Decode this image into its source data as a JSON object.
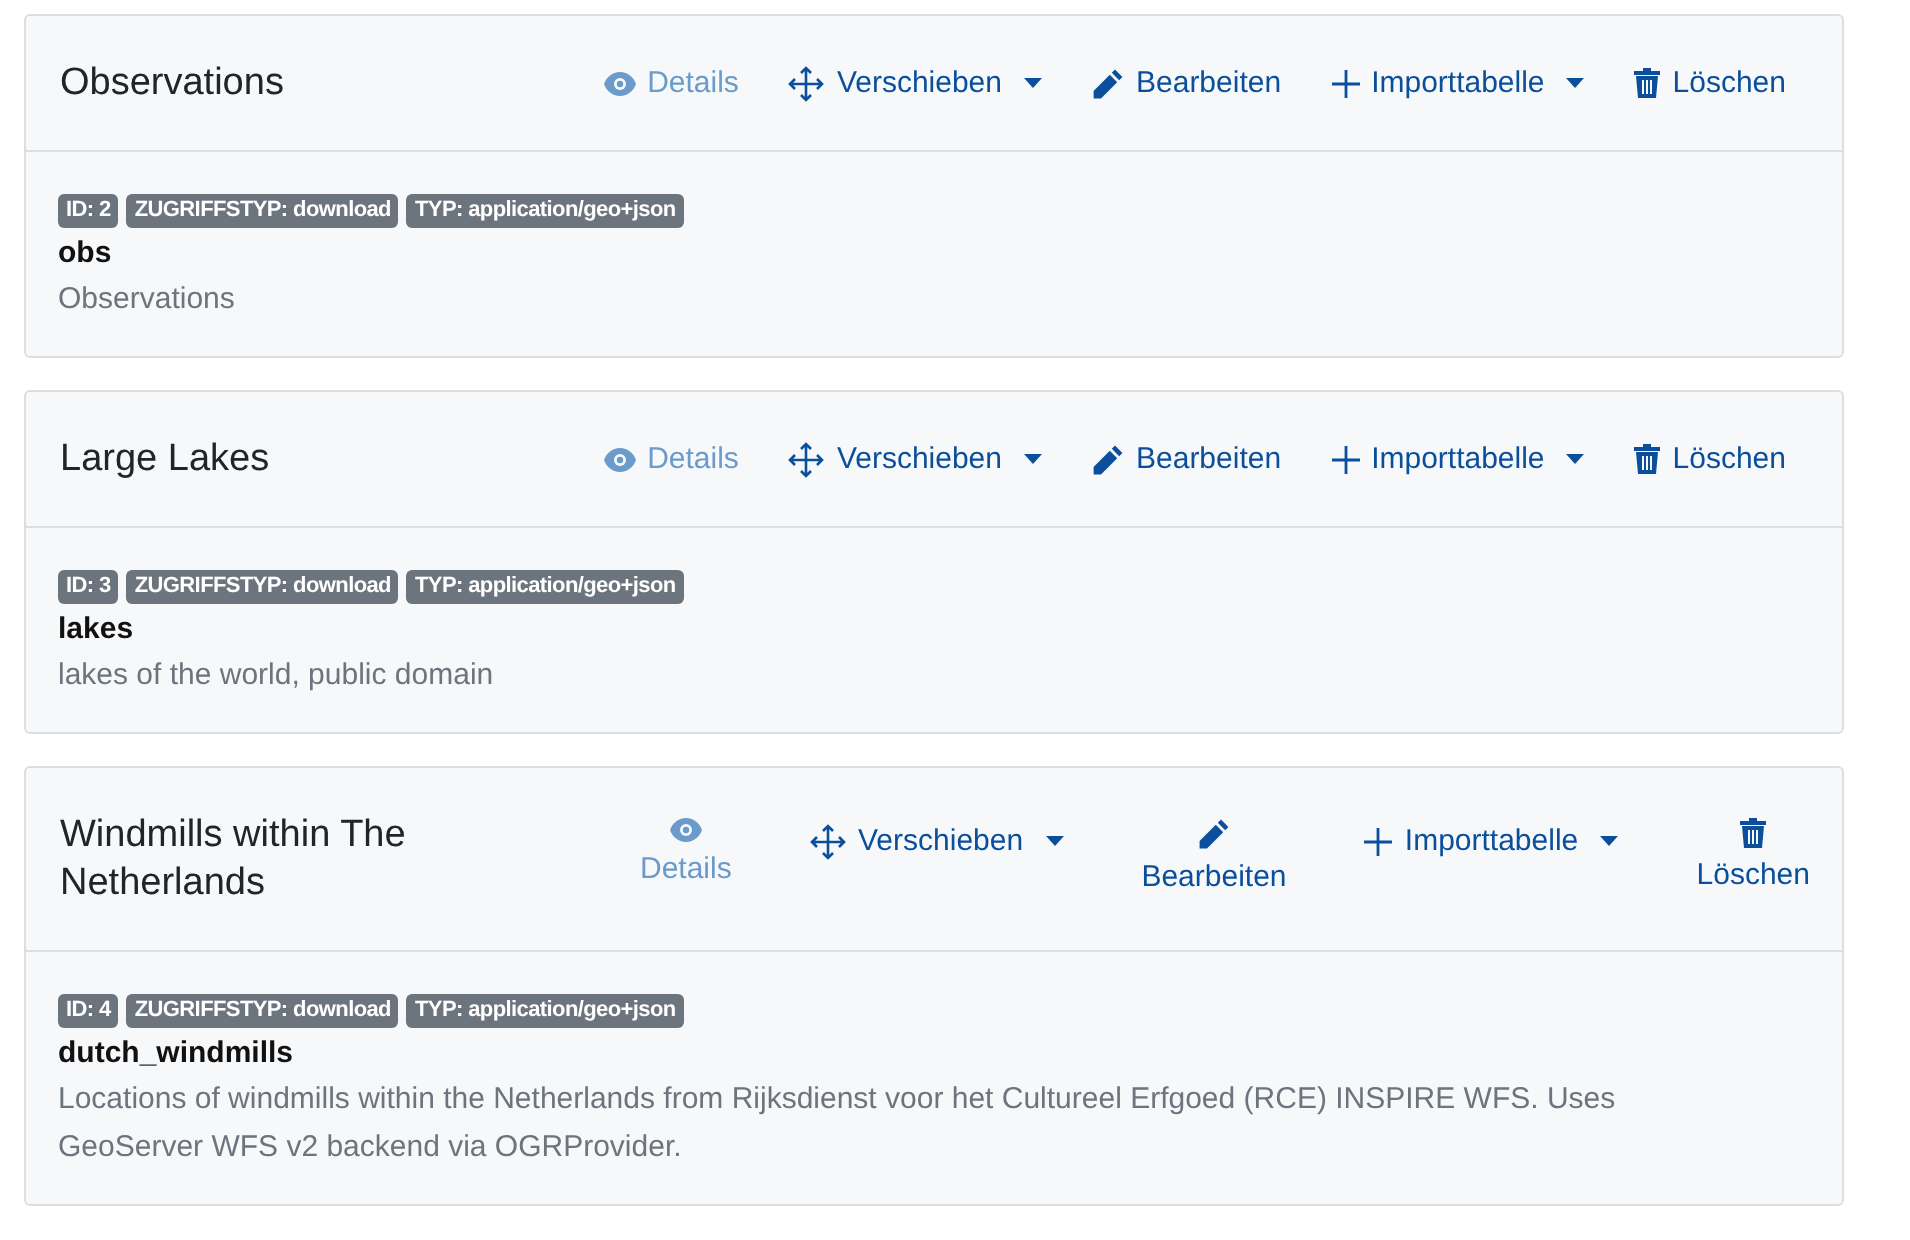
{
  "cards": [
    {
      "title": "Observations",
      "actions": [
        {
          "kind": "details",
          "label": "Details",
          "disabled": true,
          "dropdown": false
        },
        {
          "kind": "move",
          "label": "Verschieben",
          "disabled": false,
          "dropdown": true
        },
        {
          "kind": "edit",
          "label": "Bearbeiten",
          "disabled": false,
          "dropdown": false
        },
        {
          "kind": "import",
          "label": "Importtabelle",
          "disabled": false,
          "dropdown": true
        },
        {
          "kind": "delete",
          "label": "Löschen",
          "disabled": false,
          "dropdown": false
        }
      ],
      "badges": [
        "ID: 2",
        "ZUGRIFFSTYP: download",
        "TYP: application/geo+json"
      ],
      "name": "obs",
      "description": "Observations"
    },
    {
      "title": "Large Lakes",
      "actions": [
        {
          "kind": "details",
          "label": "Details",
          "disabled": true,
          "dropdown": false
        },
        {
          "kind": "move",
          "label": "Verschieben",
          "disabled": false,
          "dropdown": true
        },
        {
          "kind": "edit",
          "label": "Bearbeiten",
          "disabled": false,
          "dropdown": false
        },
        {
          "kind": "import",
          "label": "Importtabelle",
          "disabled": false,
          "dropdown": true
        },
        {
          "kind": "delete",
          "label": "Löschen",
          "disabled": false,
          "dropdown": false
        }
      ],
      "badges": [
        "ID: 3",
        "ZUGRIFFSTYP: download",
        "TYP: application/geo+json"
      ],
      "name": "lakes",
      "description": "lakes of the world, public domain"
    },
    {
      "title": "Windmills within The Netherlands",
      "actions": [
        {
          "kind": "details",
          "label": "Details",
          "disabled": true,
          "dropdown": false
        },
        {
          "kind": "move",
          "label": "Verschieben",
          "disabled": false,
          "dropdown": true
        },
        {
          "kind": "edit",
          "label": "Bearbeiten",
          "disabled": false,
          "dropdown": false
        },
        {
          "kind": "import",
          "label": "Importtabelle",
          "disabled": false,
          "dropdown": true
        },
        {
          "kind": "delete",
          "label": "Löschen",
          "disabled": false,
          "dropdown": false
        }
      ],
      "badges": [
        "ID: 4",
        "ZUGRIFFSTYP: download",
        "TYP: application/geo+json"
      ],
      "name": "dutch_windmills",
      "description": "Locations of windmills within the Netherlands from Rijksdienst voor het Cultureel Erfgoed (RCE) INSPIRE WFS. Uses GeoServer WFS v2 backend via OGRProvider."
    }
  ]
}
